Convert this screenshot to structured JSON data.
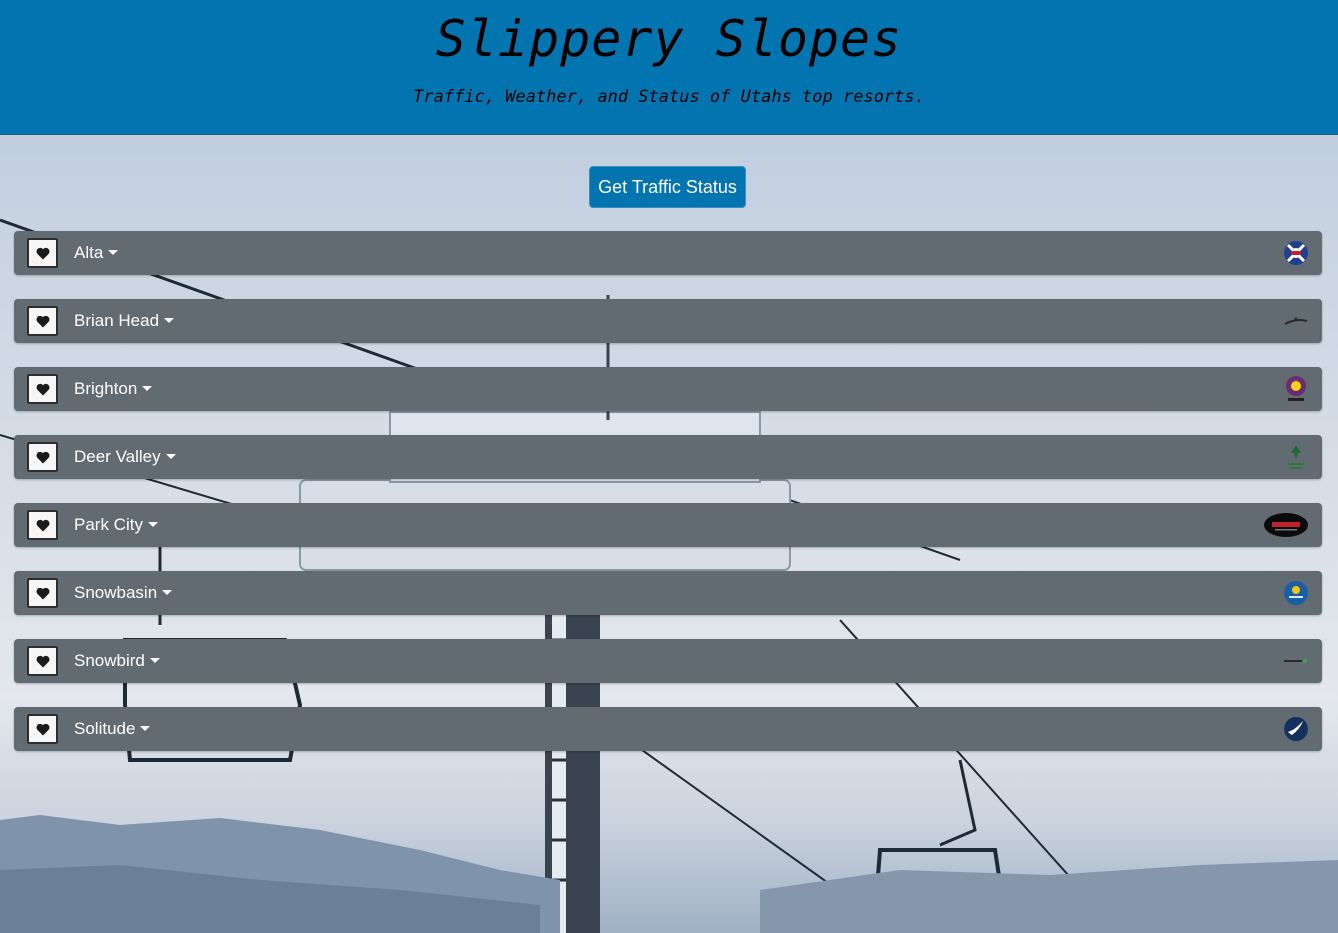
{
  "header": {
    "title": "Slippery Slopes",
    "subtitle": "Traffic, Weather, and Status of Utahs top resorts."
  },
  "traffic_button": {
    "label": "Get Traffic Status"
  },
  "colors": {
    "header_blue": "#0275b1",
    "row_gray": "#626b71",
    "button_blue": "#0275b1"
  },
  "resorts": [
    {
      "name": "Alta",
      "logo_icon": "alta-logo-icon"
    },
    {
      "name": "Brian Head",
      "logo_icon": "brian-head-logo-icon"
    },
    {
      "name": "Brighton",
      "logo_icon": "brighton-logo-icon"
    },
    {
      "name": "Deer Valley",
      "logo_icon": "deer-valley-logo-icon"
    },
    {
      "name": "Park City",
      "logo_icon": "park-city-logo-icon"
    },
    {
      "name": "Snowbasin",
      "logo_icon": "snowbasin-logo-icon"
    },
    {
      "name": "Snowbird",
      "logo_icon": "snowbird-logo-icon"
    },
    {
      "name": "Solitude",
      "logo_icon": "solitude-logo-icon"
    }
  ]
}
